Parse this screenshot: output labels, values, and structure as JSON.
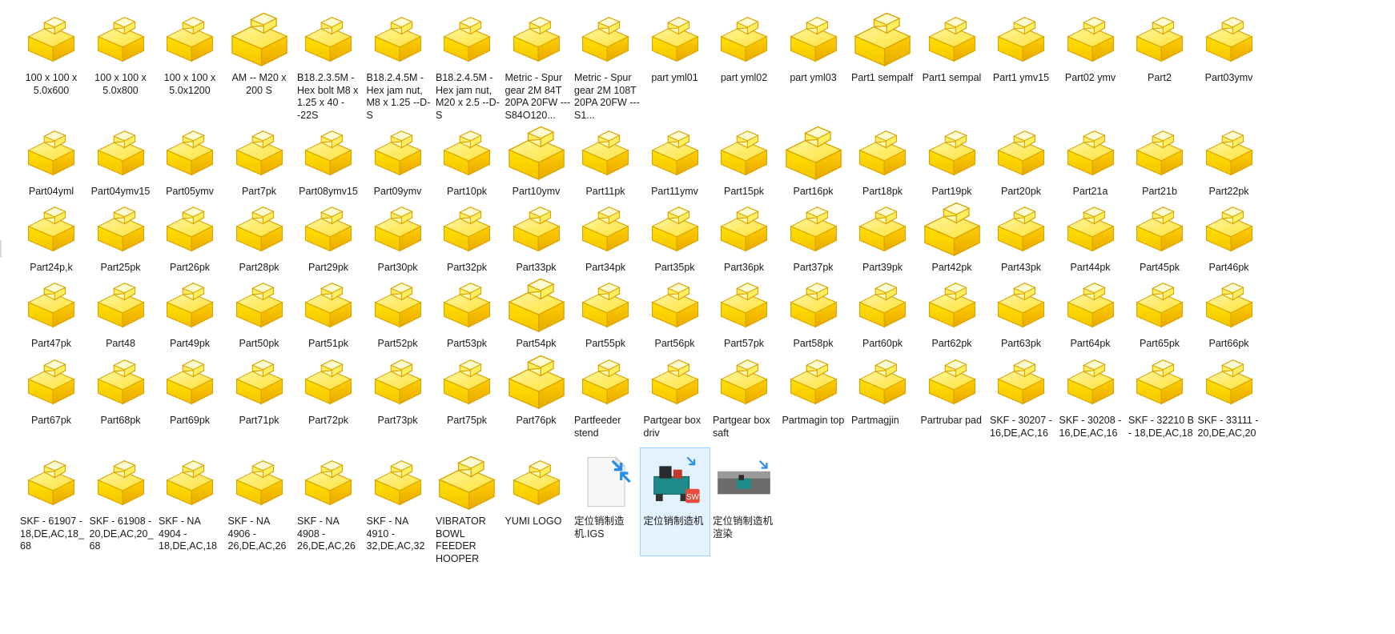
{
  "files": [
    {
      "name": "100 x 100 x 5.0x600",
      "icon": "solidworks-part-icon"
    },
    {
      "name": "100 x 100 x 5.0x800",
      "icon": "solidworks-part-icon"
    },
    {
      "name": "100 x 100 x 5.0x1200",
      "icon": "solidworks-part-icon"
    },
    {
      "name": "AM -- M20 x 200 S",
      "icon": "solidworks-part-icon"
    },
    {
      "name": "B18.2.3.5M - Hex bolt M8 x 1.25 x 40 --22S",
      "icon": "solidworks-part-icon"
    },
    {
      "name": "B18.2.4.5M - Hex jam nut, M8 x 1.25 --D-S",
      "icon": "solidworks-part-icon"
    },
    {
      "name": "B18.2.4.5M - Hex jam nut, M20 x 2.5 --D-S",
      "icon": "solidworks-part-icon"
    },
    {
      "name": "Metric - Spur gear 2M 84T 20PA 20FW ---S84O120...",
      "icon": "solidworks-part-icon"
    },
    {
      "name": "Metric - Spur gear 2M 108T 20PA 20FW ---S1...",
      "icon": "solidworks-part-icon"
    },
    {
      "name": "part yml01",
      "icon": "solidworks-part-icon"
    },
    {
      "name": "part yml02",
      "icon": "solidworks-part-icon"
    },
    {
      "name": "part yml03",
      "icon": "solidworks-part-icon"
    },
    {
      "name": "Part1 sempalf",
      "icon": "solidworks-part-icon"
    },
    {
      "name": "Part1 sempal",
      "icon": "solidworks-part-icon"
    },
    {
      "name": "Part1 ymv15",
      "icon": "solidworks-part-icon"
    },
    {
      "name": "Part02 ymv",
      "icon": "solidworks-part-icon"
    },
    {
      "name": "Part2",
      "icon": "solidworks-part-icon"
    },
    {
      "name": "Part03ymv",
      "icon": "solidworks-part-icon"
    },
    {
      "name": "Part04yml",
      "icon": "solidworks-part-icon"
    },
    {
      "name": "Part04ymv15",
      "icon": "solidworks-part-icon"
    },
    {
      "name": "Part05ymv",
      "icon": "solidworks-part-icon"
    },
    {
      "name": "Part7pk",
      "icon": "solidworks-part-icon"
    },
    {
      "name": "Part08ymv15",
      "icon": "solidworks-part-icon"
    },
    {
      "name": "Part09ymv",
      "icon": "solidworks-part-icon"
    },
    {
      "name": "Part10pk",
      "icon": "solidworks-part-icon"
    },
    {
      "name": "Part10ymv",
      "icon": "solidworks-part-icon"
    },
    {
      "name": "Part11pk",
      "icon": "solidworks-part-icon"
    },
    {
      "name": "Part11ymv",
      "icon": "solidworks-part-icon"
    },
    {
      "name": "Part15pk",
      "icon": "solidworks-part-icon"
    },
    {
      "name": "Part16pk",
      "icon": "solidworks-part-icon"
    },
    {
      "name": "Part18pk",
      "icon": "solidworks-part-icon"
    },
    {
      "name": "Part19pk",
      "icon": "solidworks-part-icon"
    },
    {
      "name": "Part20pk",
      "icon": "solidworks-part-icon"
    },
    {
      "name": "Part21a",
      "icon": "solidworks-part-icon"
    },
    {
      "name": "Part21b",
      "icon": "solidworks-part-icon"
    },
    {
      "name": "Part22pk",
      "icon": "solidworks-part-icon"
    },
    {
      "name": "Part24p,k",
      "icon": "solidworks-part-icon"
    },
    {
      "name": "Part25pk",
      "icon": "solidworks-part-icon"
    },
    {
      "name": "Part26pk",
      "icon": "solidworks-part-icon"
    },
    {
      "name": "Part28pk",
      "icon": "solidworks-part-icon"
    },
    {
      "name": "Part29pk",
      "icon": "solidworks-part-icon"
    },
    {
      "name": "Part30pk",
      "icon": "solidworks-part-icon"
    },
    {
      "name": "Part32pk",
      "icon": "solidworks-part-icon"
    },
    {
      "name": "Part33pk",
      "icon": "solidworks-part-icon"
    },
    {
      "name": "Part34pk",
      "icon": "solidworks-part-icon"
    },
    {
      "name": "Part35pk",
      "icon": "solidworks-part-icon"
    },
    {
      "name": "Part36pk",
      "icon": "solidworks-part-icon"
    },
    {
      "name": "Part37pk",
      "icon": "solidworks-part-icon"
    },
    {
      "name": "Part39pk",
      "icon": "solidworks-part-icon"
    },
    {
      "name": "Part42pk",
      "icon": "solidworks-part-icon"
    },
    {
      "name": "Part43pk",
      "icon": "solidworks-part-icon"
    },
    {
      "name": "Part44pk",
      "icon": "solidworks-part-icon"
    },
    {
      "name": "Part45pk",
      "icon": "solidworks-part-icon"
    },
    {
      "name": "Part46pk",
      "icon": "solidworks-part-icon"
    },
    {
      "name": "Part47pk",
      "icon": "solidworks-part-icon"
    },
    {
      "name": "Part48",
      "icon": "solidworks-part-icon"
    },
    {
      "name": "Part49pk",
      "icon": "solidworks-part-icon"
    },
    {
      "name": "Part50pk",
      "icon": "solidworks-part-icon"
    },
    {
      "name": "Part51pk",
      "icon": "solidworks-part-icon"
    },
    {
      "name": "Part52pk",
      "icon": "solidworks-part-icon"
    },
    {
      "name": "Part53pk",
      "icon": "solidworks-part-icon"
    },
    {
      "name": "Part54pk",
      "icon": "solidworks-part-icon"
    },
    {
      "name": "Part55pk",
      "icon": "solidworks-part-icon"
    },
    {
      "name": "Part56pk",
      "icon": "solidworks-part-icon"
    },
    {
      "name": "Part57pk",
      "icon": "solidworks-part-icon"
    },
    {
      "name": "Part58pk",
      "icon": "solidworks-part-icon"
    },
    {
      "name": "Part60pk",
      "icon": "solidworks-part-icon"
    },
    {
      "name": "Part62pk",
      "icon": "solidworks-part-icon"
    },
    {
      "name": "Part63pk",
      "icon": "solidworks-part-icon"
    },
    {
      "name": "Part64pk",
      "icon": "solidworks-part-icon"
    },
    {
      "name": "Part65pk",
      "icon": "solidworks-part-icon"
    },
    {
      "name": "Part66pk",
      "icon": "solidworks-part-icon"
    },
    {
      "name": "Part67pk",
      "icon": "solidworks-part-icon"
    },
    {
      "name": "Part68pk",
      "icon": "solidworks-part-icon"
    },
    {
      "name": "Part69pk",
      "icon": "solidworks-part-icon"
    },
    {
      "name": "Part71pk",
      "icon": "solidworks-part-icon"
    },
    {
      "name": "Part72pk",
      "icon": "solidworks-part-icon"
    },
    {
      "name": "Part73pk",
      "icon": "solidworks-part-icon"
    },
    {
      "name": "Part75pk",
      "icon": "solidworks-part-icon"
    },
    {
      "name": "Part76pk",
      "icon": "solidworks-part-icon"
    },
    {
      "name": "Partfeeder stend",
      "icon": "solidworks-part-icon"
    },
    {
      "name": "Partgear box driv",
      "icon": "solidworks-part-icon"
    },
    {
      "name": "Partgear box saft",
      "icon": "solidworks-part-icon"
    },
    {
      "name": "Partmagin top",
      "icon": "solidworks-part-icon"
    },
    {
      "name": "Partmagjin",
      "icon": "solidworks-part-icon"
    },
    {
      "name": "Partrubar pad",
      "icon": "solidworks-part-icon"
    },
    {
      "name": "SKF - 30207 - 16,DE,AC,16",
      "icon": "solidworks-part-icon"
    },
    {
      "name": "SKF - 30208 - 16,DE,AC,16",
      "icon": "solidworks-part-icon"
    },
    {
      "name": "SKF - 32210 B - 18,DE,AC,18",
      "icon": "solidworks-part-icon"
    },
    {
      "name": "SKF - 33111 - 20,DE,AC,20",
      "icon": "solidworks-part-icon"
    },
    {
      "name": "SKF - 61907 - 18,DE,AC,18_68",
      "icon": "solidworks-part-icon"
    },
    {
      "name": "SKF - 61908 - 20,DE,AC,20_68",
      "icon": "solidworks-part-icon"
    },
    {
      "name": "SKF - NA 4904 - 18,DE,AC,18",
      "icon": "solidworks-part-icon"
    },
    {
      "name": "SKF - NA 4906 - 26,DE,AC,26",
      "icon": "solidworks-part-icon"
    },
    {
      "name": "SKF - NA 4908 - 26,DE,AC,26",
      "icon": "solidworks-part-icon"
    },
    {
      "name": "SKF - NA 4910 - 32,DE,AC,32",
      "icon": "solidworks-part-icon"
    },
    {
      "name": "VIBRATOR BOWL FEEDER HOOPER",
      "icon": "solidworks-part-icon"
    },
    {
      "name": "YUMI LOGO",
      "icon": "solidworks-part-icon"
    },
    {
      "name": "定位销制造机.IGS",
      "icon": "igs-file-icon"
    },
    {
      "name": "定位销制造机",
      "icon": "solidworks-assembly-icon",
      "selected": true
    },
    {
      "name": "定位销制造机渲染",
      "icon": "render-image-icon"
    }
  ],
  "colors": {
    "selection_bg": "#cce8ff",
    "selection_border": "#99d1ff",
    "part_yellow": "#ffd700",
    "text": "#1a1a1a"
  }
}
